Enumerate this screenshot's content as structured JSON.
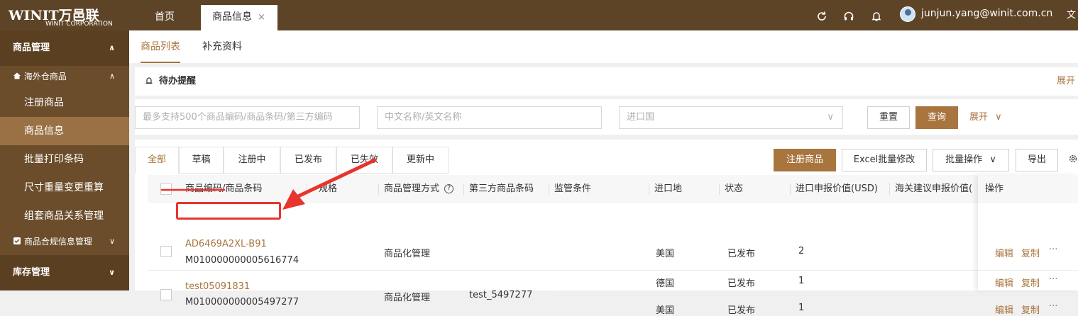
{
  "header": {
    "logo_text": "WINIT万邑联",
    "logo_sub": "WINIT CORPORATION",
    "tabs": [
      {
        "label": "首页",
        "active": false
      },
      {
        "label": "商品信息",
        "active": true
      }
    ],
    "close_glyph": "×",
    "user_email": "junjun.yang@winit.com.cn",
    "icons": [
      "refresh-icon",
      "headset-icon",
      "bell-icon",
      "translate-icon"
    ],
    "translate_glyph": "文A"
  },
  "sidebar": {
    "section_goods": "商品管理",
    "sub_overseas": "海外仓商品",
    "items": [
      {
        "label": "注册商品",
        "active": false
      },
      {
        "label": "商品信息",
        "active": true
      },
      {
        "label": "批量打印条码",
        "active": false
      },
      {
        "label": "尺寸重量变更重算",
        "active": false
      },
      {
        "label": "组套商品关系管理",
        "active": false
      }
    ],
    "sub_compliance": "商品合规信息管理",
    "section_stock": "库存管理"
  },
  "main": {
    "subtabs": [
      "商品列表",
      "补充资料"
    ],
    "todo_label": "待办提醒",
    "expand_label": "展开",
    "filters": {
      "code_placeholder": "最多支持500个商品编码/商品条码/第三方编码",
      "name_placeholder": "中文名称/英文名称",
      "country_placeholder": "进口国",
      "reset_label": "重置",
      "query_label": "查询",
      "expand_label": "展开"
    },
    "status_tabs": [
      "全部",
      "草稿",
      "注册中",
      "已发布",
      "已失效",
      "更新中"
    ],
    "actions": {
      "register": "注册商品",
      "excel": "Excel批量修改",
      "batch": "批量操作",
      "export": "导出"
    },
    "columns": [
      "商品编码/商品条码",
      "规格",
      "商品管理方式",
      "第三方商品条码",
      "监管条件",
      "进口地",
      "状态",
      "进口申报价值(USD)",
      "海关建议申报价值(",
      "操作"
    ],
    "rows": [
      {
        "code": "AD6469A2XL-B91",
        "barcode": "M010000000005616774",
        "manage": "商品化管理",
        "third": "",
        "lines": [
          {
            "country": "美国",
            "status": "已发布",
            "value": "2"
          }
        ]
      },
      {
        "code": "test05091831",
        "barcode": "M010000000005497277",
        "manage": "商品化管理",
        "third": "test_5497277",
        "lines": [
          {
            "country": "德国",
            "status": "已发布",
            "value": "1"
          },
          {
            "country": "美国",
            "status": "已发布",
            "value": "1"
          }
        ]
      }
    ],
    "ops": {
      "edit": "编辑",
      "copy": "复制",
      "more": "···"
    }
  },
  "colors": {
    "header_bg": "#5e4426",
    "sidebar_bg": "#6b4d2b",
    "sidebar_active": "#9a7145",
    "accent": "#a8753f",
    "annotation_red": "#e8342e"
  }
}
